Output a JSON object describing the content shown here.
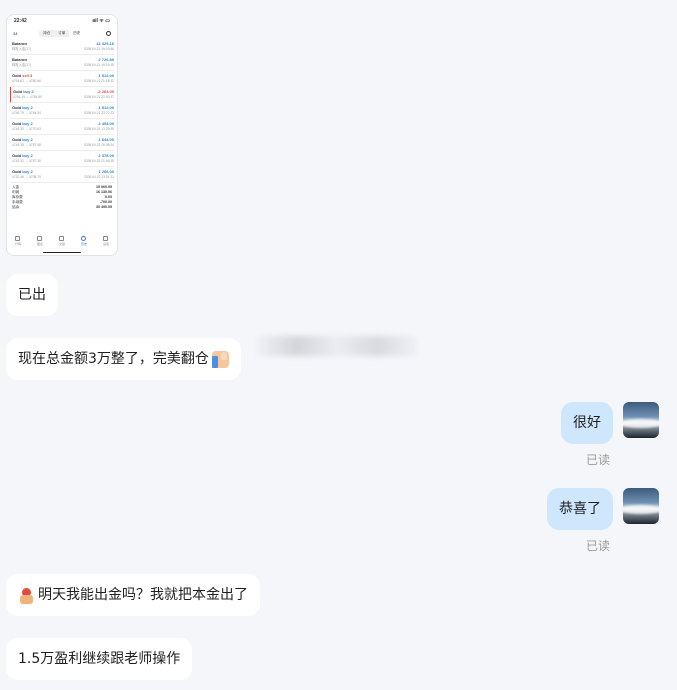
{
  "screenshot": {
    "status_time": "22:42",
    "status_icons": "ail ᯤ ▭",
    "account_label": "34",
    "segments": [
      "持仓",
      "订单",
      "历史"
    ],
    "rows": [
      {
        "title": "Balance",
        "sub": "转账入金(17)",
        "amount": "12 325.16",
        "time": "2026.04.21 19:03:56",
        "neg": false
      },
      {
        "title": "Balance",
        "sub": "转账入金(17)",
        "amount": "2 726.89",
        "time": "2026.04.21 19:19:15",
        "neg": false
      },
      {
        "title_main": "Gold",
        "title_side": "sell 3",
        "side_type": "sell",
        "sub": "4764.62 → 4760.66",
        "amount": "1 512.00",
        "time": "2026.04.21 21:18:12",
        "neg": false
      },
      {
        "title_main": "Gold",
        "title_side": "buy 2",
        "side_type": "buy",
        "sub": "4766.19 → 4754.80",
        "amount": "-2 264.00",
        "time": "2026.04.21 22:40:37",
        "neg": true,
        "mark": true
      },
      {
        "title_main": "Gold",
        "title_side": "buy 2",
        "side_type": "buy",
        "sub": "4756.79 → 4764.34",
        "amount": "1 512.00",
        "time": "2026.04.21 23:22:23",
        "neg": false
      },
      {
        "title_main": "Gold",
        "title_side": "buy 2",
        "side_type": "buy",
        "sub": "4748.30 → 4770.63",
        "amount": "2 454.00",
        "time": "2026.04.22 13:29:49",
        "neg": false
      },
      {
        "title_main": "Gold",
        "title_side": "buy 2",
        "side_type": "buy",
        "sub": "4749.18 → 4757.58",
        "amount": "1 644.00",
        "time": "2026.04.22 16:38:24",
        "neg": false
      },
      {
        "title_main": "Gold",
        "title_side": "buy 2",
        "side_type": "buy",
        "sub": "4745.32 → 4757.30",
        "amount": "2 378.00",
        "time": "2026.04.22 21:46:15",
        "neg": false
      },
      {
        "title_main": "Gold",
        "title_side": "buy 2",
        "side_type": "buy",
        "sub": "4732.46 → 4738.79",
        "amount": "1 266.00",
        "time": "2026.04.22 23:01:11",
        "neg": false
      }
    ],
    "summary": [
      {
        "label": "入金",
        "value": "15 060.05"
      },
      {
        "label": "利润",
        "value": "16 130.06"
      },
      {
        "label": "库存费",
        "value": "0.00"
      },
      {
        "label": "手续费",
        "value": "-700.00"
      },
      {
        "label": "结余",
        "value": "30 490.05"
      }
    ],
    "tabs": [
      {
        "label": "行情",
        "active": false
      },
      {
        "label": "图表",
        "active": false
      },
      {
        "label": "交易",
        "active": false
      },
      {
        "label": "历史",
        "active": true
      },
      {
        "label": "设置",
        "active": false
      }
    ]
  },
  "messages": [
    {
      "text": "已出"
    },
    {
      "text": "现在总金额3万整了，完美翻仓"
    },
    {
      "text": "很好",
      "status": "已读"
    },
    {
      "text": "恭喜了",
      "status": "已读"
    },
    {
      "text": "明天我能出金吗？我就把本金出了"
    },
    {
      "text": "1.5万盈利继续跟老师操作"
    }
  ]
}
